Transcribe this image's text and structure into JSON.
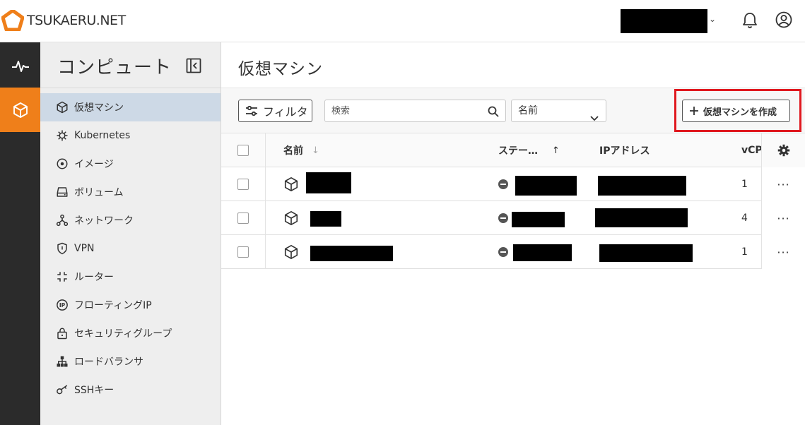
{
  "brand": {
    "name": "TSUKAERU.NET",
    "accent": "#ef7f1a"
  },
  "header": {
    "account_chevron": "⌄",
    "bell_icon": "bell-icon",
    "user_icon": "user-circle-icon"
  },
  "rail": {
    "items": [
      {
        "icon": "activity-icon"
      },
      {
        "icon": "cube-icon",
        "active": true
      }
    ]
  },
  "sidebar": {
    "title": "コンピュート",
    "items": [
      {
        "label": "仮想マシン",
        "icon": "cube-icon",
        "active": true
      },
      {
        "label": "Kubernetes",
        "icon": "helm-icon"
      },
      {
        "label": "イメージ",
        "icon": "disc-icon"
      },
      {
        "label": "ボリューム",
        "icon": "drive-icon"
      },
      {
        "label": "ネットワーク",
        "icon": "network-icon"
      },
      {
        "label": "VPN",
        "icon": "shield-icon"
      },
      {
        "label": "ルーター",
        "icon": "router-icon"
      },
      {
        "label": "フローティングIP",
        "icon": "ip-icon"
      },
      {
        "label": "セキュリティグループ",
        "icon": "lock-icon"
      },
      {
        "label": "ロードバランサ",
        "icon": "load-balancer-icon"
      },
      {
        "label": "SSHキー",
        "icon": "key-icon"
      }
    ]
  },
  "main": {
    "title": "仮想マシン",
    "filter_label": "フィルタ",
    "search_placeholder": "検索",
    "select_value": "名前",
    "create_label": "仮想マシンを作成",
    "highlight_color": "#e0181f"
  },
  "table": {
    "headers": {
      "name": "名前",
      "status": "ステー…",
      "ip": "IPアドレス",
      "vcpu": "vCPU"
    },
    "rows": [
      {
        "vcpu": "1"
      },
      {
        "vcpu": "4"
      },
      {
        "vcpu": "1"
      }
    ],
    "row_action": "···"
  }
}
